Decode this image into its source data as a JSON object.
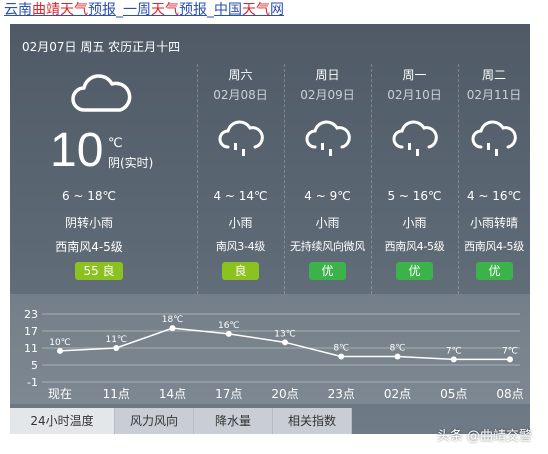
{
  "breadcrumb": {
    "link1": {
      "p1": "云南",
      "p2": "曲靖",
      "p3": "天气",
      "p4": "预报"
    },
    "link2": {
      "p1": "一周",
      "p2": "天气",
      "p3": "预报"
    },
    "link3": {
      "p1": "中国",
      "p2": "天气",
      "p3": "网"
    },
    "sep": "_"
  },
  "today": {
    "date_line": "02月07日 周五 农历正月十四",
    "icon": "cloudy-icon",
    "temp": "10",
    "unit": "℃",
    "state": "阴(实时)",
    "range": "6 ~ 18℃",
    "weather": "阴转小雨",
    "wind": "西南风4-5级",
    "aqi": "55 良"
  },
  "days": [
    {
      "weekday": "周六",
      "date": "02月08日",
      "temp": "4 ~ 14℃",
      "weather": "小雨",
      "wind": "南风3-4级",
      "aqi": "良",
      "aqi_color": "#8cc21f",
      "icon": "rain-icon"
    },
    {
      "weekday": "周日",
      "date": "02月09日",
      "temp": "4 ~ 9℃",
      "weather": "小雨",
      "wind": "无持续风向微风",
      "aqi": "优",
      "aqi_color": "#3bb34a",
      "icon": "rain-icon"
    },
    {
      "weekday": "周一",
      "date": "02月10日",
      "temp": "5 ~ 16℃",
      "weather": "小雨",
      "wind": "西南风4-5级",
      "aqi": "优",
      "aqi_color": "#3bb34a",
      "icon": "rain-icon"
    },
    {
      "weekday": "周二",
      "date": "02月11日",
      "temp": "4 ~ 16℃",
      "weather": "小雨转晴",
      "wind": "西南风4-5级",
      "aqi": "优",
      "aqi_color": "#3bb34a",
      "icon": "rain-icon"
    }
  ],
  "chart_data": {
    "type": "line",
    "categories": [
      "现在",
      "11点",
      "14点",
      "17点",
      "20点",
      "23点",
      "02点",
      "05点",
      "08点"
    ],
    "values": [
      10,
      11,
      18,
      16,
      13,
      8,
      8,
      7,
      7
    ],
    "value_labels": [
      "10℃",
      "11℃",
      "18℃",
      "16℃",
      "13℃",
      "8℃",
      "8℃",
      "7℃",
      "7℃"
    ],
    "yticks": [
      "23",
      "17",
      "11",
      "5",
      "-1"
    ],
    "ylim": [
      -1,
      23
    ],
    "grid": true
  },
  "tabs": [
    "24小时温度",
    "风力风向",
    "降水量",
    "相关指数"
  ],
  "watermark": "头条 @曲靖交警",
  "colors": {
    "link": "#2b4fb3",
    "highlight": "#d8262d",
    "aqi_good": "#8cc21f",
    "aqi_excellent": "#3bb34a"
  }
}
